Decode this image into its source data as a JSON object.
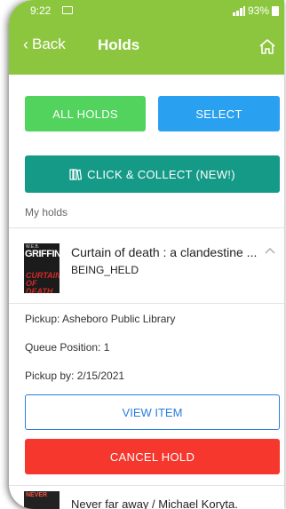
{
  "status_bar": {
    "time": "9:22",
    "battery": "93%"
  },
  "header": {
    "back_label": "Back",
    "title": "Holds"
  },
  "actions": {
    "all_holds": "ALL HOLDS",
    "select": "SELECT",
    "click_collect": "CLICK & COLLECT (NEW!)"
  },
  "section": {
    "label": "My holds"
  },
  "holds": [
    {
      "cover_author": "GRIFFIN",
      "cover_top": "W.E.B.",
      "cover_title_lines": [
        "CURTAIN",
        "OF DEATH"
      ],
      "title": "Curtain of death : a clandestine ...",
      "status": "BEING_HELD",
      "pickup": "Pickup: Asheboro Public Library",
      "queue": "Queue Position: 1",
      "pickup_by": "Pickup by: 2/15/2021",
      "view_label": "VIEW ITEM",
      "cancel_label": "CANCEL HOLD"
    },
    {
      "cover_text": "NEVER",
      "title": "Never far away / Michael Koryta."
    }
  ],
  "colors": {
    "header": "#8cc63f",
    "all_holds": "#52d35e",
    "select": "#2aa0f0",
    "collect": "#159a88",
    "view_border": "#2a7de0",
    "cancel": "#f5372e"
  }
}
